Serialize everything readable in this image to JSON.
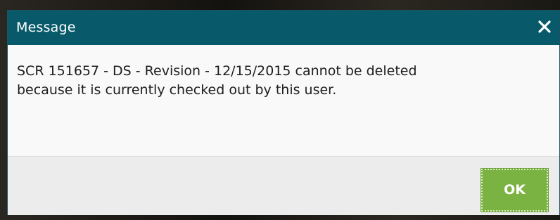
{
  "dialog": {
    "title": "Message",
    "close_icon": "close-icon",
    "message_line1": "SCR 151657 - DS - Revision - 12/15/2015 cannot be deleted",
    "message_line2": "because it is currently checked out by this user.",
    "ok_label": "OK"
  },
  "colors": {
    "titlebar": "#085a6b",
    "ok_button": "#7bb342",
    "body_bg": "#f9f9f9",
    "footer_bg": "#ececec"
  }
}
